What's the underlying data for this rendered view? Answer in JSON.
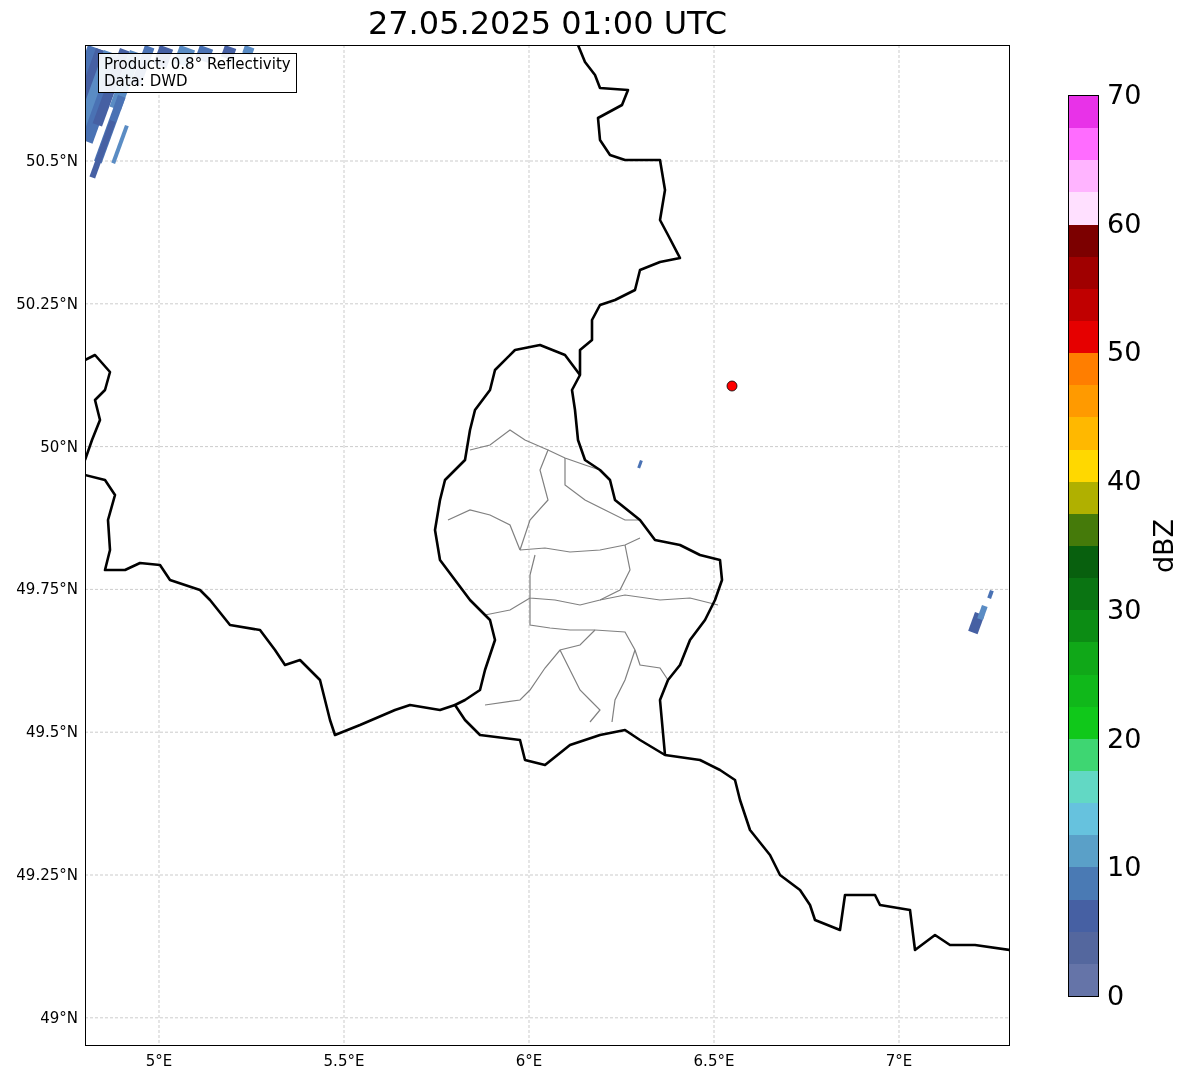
{
  "title": "27.05.2025 01:00 UTC",
  "annotation": {
    "lines": [
      "Product: 0.8° Reflectivity",
      "Data: DWD"
    ]
  },
  "map": {
    "y_ticks": [
      "50.5°N",
      "50.25°N",
      "50°N",
      "49.75°N",
      "49.5°N",
      "49.25°N",
      "49°N"
    ],
    "x_ticks": [
      "5°E",
      "5.5°E",
      "6°E",
      "6.5°E",
      "7°E"
    ]
  },
  "colorbar": {
    "label": "dBZ",
    "ticks": [
      "70",
      "60",
      "50",
      "40",
      "30",
      "20",
      "10",
      "0"
    ],
    "bands": [
      {
        "color": "#6574a8"
      },
      {
        "color": "#54679e"
      },
      {
        "color": "#4660a3"
      },
      {
        "color": "#4a7ab4"
      },
      {
        "color": "#5aa0c8"
      },
      {
        "color": "#66c2de"
      },
      {
        "color": "#62d8c4"
      },
      {
        "color": "#3ed672"
      },
      {
        "color": "#10c81a"
      },
      {
        "color": "#10b81a"
      },
      {
        "color": "#10a818"
      },
      {
        "color": "#0c8c14"
      },
      {
        "color": "#0a7412"
      },
      {
        "color": "#08600e"
      },
      {
        "color": "#457a0a"
      },
      {
        "color": "#b0b000"
      },
      {
        "color": "#ffd800"
      },
      {
        "color": "#ffb800"
      },
      {
        "color": "#ff9a00"
      },
      {
        "color": "#ff7e00"
      },
      {
        "color": "#e60000"
      },
      {
        "color": "#c00000"
      },
      {
        "color": "#a00000"
      },
      {
        "color": "#7c0000"
      },
      {
        "color": "#ffe0ff"
      },
      {
        "color": "#ffb4ff"
      },
      {
        "color": "#ff6cff"
      },
      {
        "color": "#e832e8"
      }
    ]
  }
}
